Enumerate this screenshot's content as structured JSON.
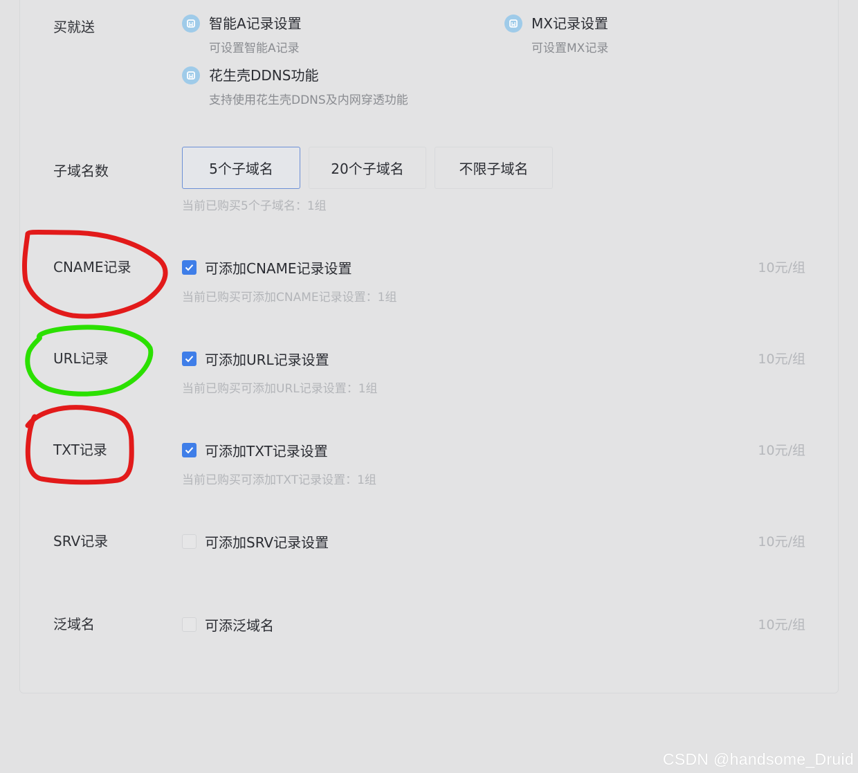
{
  "gift": {
    "label": "买就送",
    "features": [
      {
        "icon": "bookmark-icon",
        "title": "智能A记录设置",
        "desc": "可设置智能A记录"
      },
      {
        "icon": "bookmark-icon",
        "title": "MX记录设置",
        "desc": "可设置MX记录"
      },
      {
        "icon": "bookmark-icon",
        "title": "花生壳DDNS功能",
        "desc": "支持使用花生壳DDNS及内网穿透功能"
      }
    ]
  },
  "subdomains": {
    "label": "子域名数",
    "options": [
      {
        "label": "5个子域名",
        "selected": true
      },
      {
        "label": "20个子域名",
        "selected": false
      },
      {
        "label": "不限子域名",
        "selected": false
      }
    ],
    "hint": "当前已购买5个子域名：1组"
  },
  "records": [
    {
      "label": "CNAME记录",
      "option": "可添加CNAME记录设置",
      "checked": true,
      "hint": "当前已购买可添加CNAME记录设置：1组",
      "price": "10元/组"
    },
    {
      "label": "URL记录",
      "option": "可添加URL记录设置",
      "checked": true,
      "hint": "当前已购买可添加URL记录设置：1组",
      "price": "10元/组"
    },
    {
      "label": "TXT记录",
      "option": "可添加TXT记录设置",
      "checked": true,
      "hint": "当前已购买可添加TXT记录设置：1组",
      "price": "10元/组"
    },
    {
      "label": "SRV记录",
      "option": "可添加SRV记录设置",
      "checked": false,
      "hint": "",
      "price": "10元/组"
    },
    {
      "label": "泛域名",
      "option": "可添泛域名",
      "checked": false,
      "hint": "",
      "price": "10元/组"
    }
  ],
  "annotations": {
    "cname_circle_color": "#e21a1a",
    "url_circle_color": "#2be000",
    "txt_circle_color": "#e21a1a"
  },
  "watermark": "CSDN @handsome_Druid",
  "colors": {
    "accent": "#3f7ee8",
    "background": "#e2e2e3",
    "icon_bg": "#9fcbe9"
  }
}
